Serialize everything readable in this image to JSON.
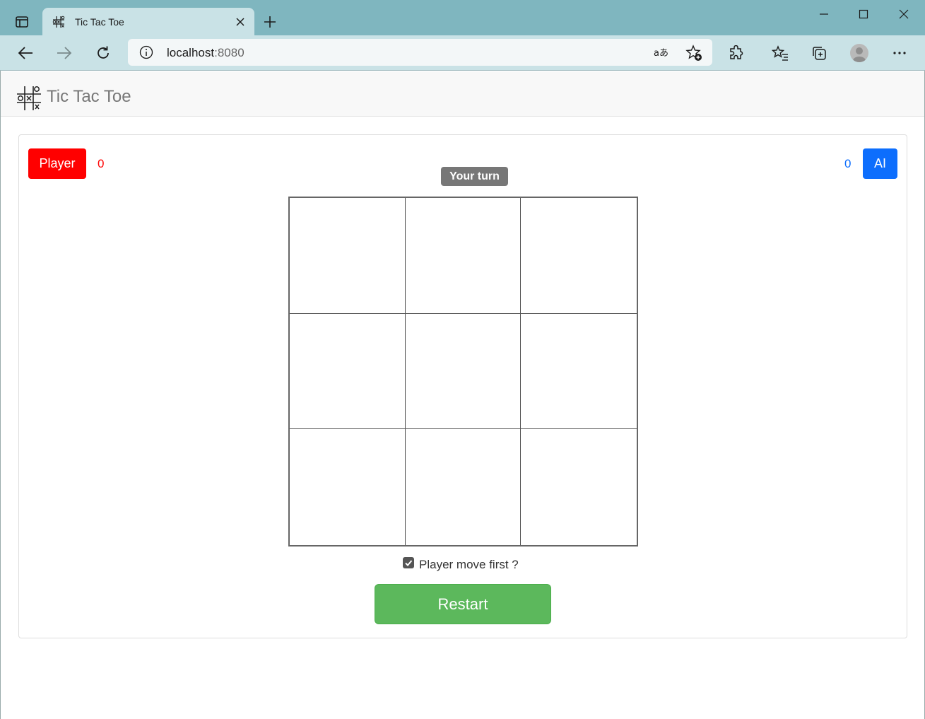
{
  "browser": {
    "tab_title": "Tic Tac Toe",
    "address": {
      "host": "localhost",
      "port": ":8080"
    }
  },
  "navbar": {
    "brand": "Tic Tac Toe"
  },
  "scoreboard": {
    "player_label": "Player",
    "player_score": "0",
    "ai_label": "AI",
    "ai_score": "0",
    "player_color": "#ff0000",
    "ai_color": "#0d6efd"
  },
  "status": {
    "turn": "Your turn"
  },
  "board": {
    "cells": [
      "",
      "",
      "",
      "",
      "",
      "",
      "",
      "",
      ""
    ]
  },
  "options": {
    "player_first_label": "Player move first ?",
    "player_first_checked": true
  },
  "actions": {
    "restart_label": "Restart",
    "restart_color": "#5cb85c"
  }
}
